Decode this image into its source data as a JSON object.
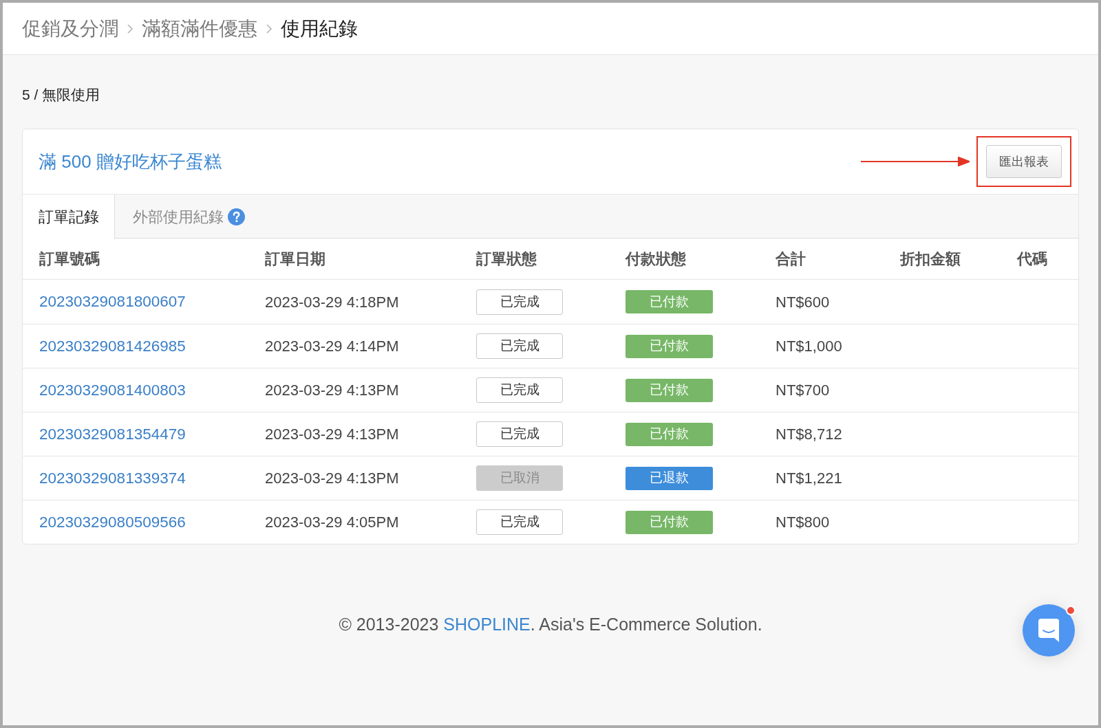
{
  "breadcrumb": [
    {
      "label": "促銷及分潤",
      "current": false
    },
    {
      "label": "滿額滿件優惠",
      "current": false
    },
    {
      "label": "使用紀錄",
      "current": true
    }
  ],
  "usage": "5 / 無限使用",
  "promotion": {
    "title": "滿 500 贈好吃杯子蛋糕",
    "export_button": {
      "label": "匯出報表",
      "highlighted": true
    }
  },
  "tabs": [
    {
      "label": "訂單記錄",
      "selected": true,
      "help_icon": false
    },
    {
      "label": "外部使用紀錄",
      "selected": false,
      "help_icon": true
    }
  ],
  "table": {
    "columns": [
      "訂單號碼",
      "訂單日期",
      "訂單狀態",
      "付款狀態",
      "合計",
      "折扣金額",
      "代碼"
    ],
    "rows": [
      {
        "order_number": "20230329081800607",
        "date": "2023-03-29 4:18PM",
        "order_status": {
          "label": "已完成",
          "kind": "completed"
        },
        "payment_status": {
          "label": "已付款",
          "color": "#77b767"
        },
        "total": "NT$600"
      },
      {
        "order_number": "20230329081426985",
        "date": "2023-03-29 4:14PM",
        "order_status": {
          "label": "已完成",
          "kind": "completed"
        },
        "payment_status": {
          "label": "已付款",
          "color": "#77b767"
        },
        "total": "NT$1,000"
      },
      {
        "order_number": "20230329081400803",
        "date": "2023-03-29 4:13PM",
        "order_status": {
          "label": "已完成",
          "kind": "completed"
        },
        "payment_status": {
          "label": "已付款",
          "color": "#77b767"
        },
        "total": "NT$700"
      },
      {
        "order_number": "20230329081354479",
        "date": "2023-03-29 4:13PM",
        "order_status": {
          "label": "已完成",
          "kind": "completed"
        },
        "payment_status": {
          "label": "已付款",
          "color": "#77b767"
        },
        "total": "NT$8,712"
      },
      {
        "order_number": "20230329081339374",
        "date": "2023-03-29 4:13PM",
        "order_status": {
          "label": "已取消",
          "kind": "cancelled"
        },
        "payment_status": {
          "label": "已退款",
          "color": "#3d8ddb"
        },
        "total": "NT$1,221"
      },
      {
        "order_number": "20230329080509566",
        "date": "2023-03-29 4:05PM",
        "order_status": {
          "label": "已完成",
          "kind": "completed"
        },
        "payment_status": {
          "label": "已付款",
          "color": "#77b767"
        },
        "total": "NT$800"
      }
    ]
  },
  "footer": {
    "prefix": "© 2013-2023",
    "link": "SHOPLINE",
    "suffix": ". Asia's E-Commerce Solution."
  },
  "chat_button": {
    "notification": true
  }
}
